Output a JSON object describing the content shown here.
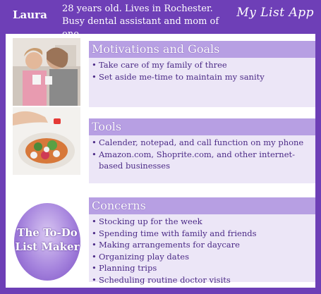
{
  "header": {
    "name": "Laura",
    "bio_line1": "28 years old. Lives in Rochester.",
    "bio_line2": "Busy dental assistant and mom of one.",
    "app_name": "My List App"
  },
  "sections": [
    {
      "title": "Motivations and Goals",
      "items": [
        "Take care of my family of three",
        "Set aside me-time to maintain my sanity"
      ]
    },
    {
      "title": "Tools",
      "items": [
        " Calender, notepad, and call function on my phone",
        " Amazon.com, Shoprite.com, and other internet-based businesses"
      ]
    },
    {
      "title": "Concerns",
      "items": [
        "Stocking up for the week",
        "Spending time with family and friends",
        "Making arrangements for daycare",
        "Organizing play dates",
        "Planning trips",
        "Scheduling routine doctor visits"
      ]
    }
  ],
  "badge": {
    "line1": "The To-Do",
    "line2": "List Maker"
  },
  "colors": {
    "frame": "#6e3fb7",
    "section_header": "#b79fe3",
    "section_body": "#ece6f7",
    "text": "#4b2a86"
  },
  "images": [
    "mother-daughter-photo",
    "cooking-food-photo"
  ]
}
